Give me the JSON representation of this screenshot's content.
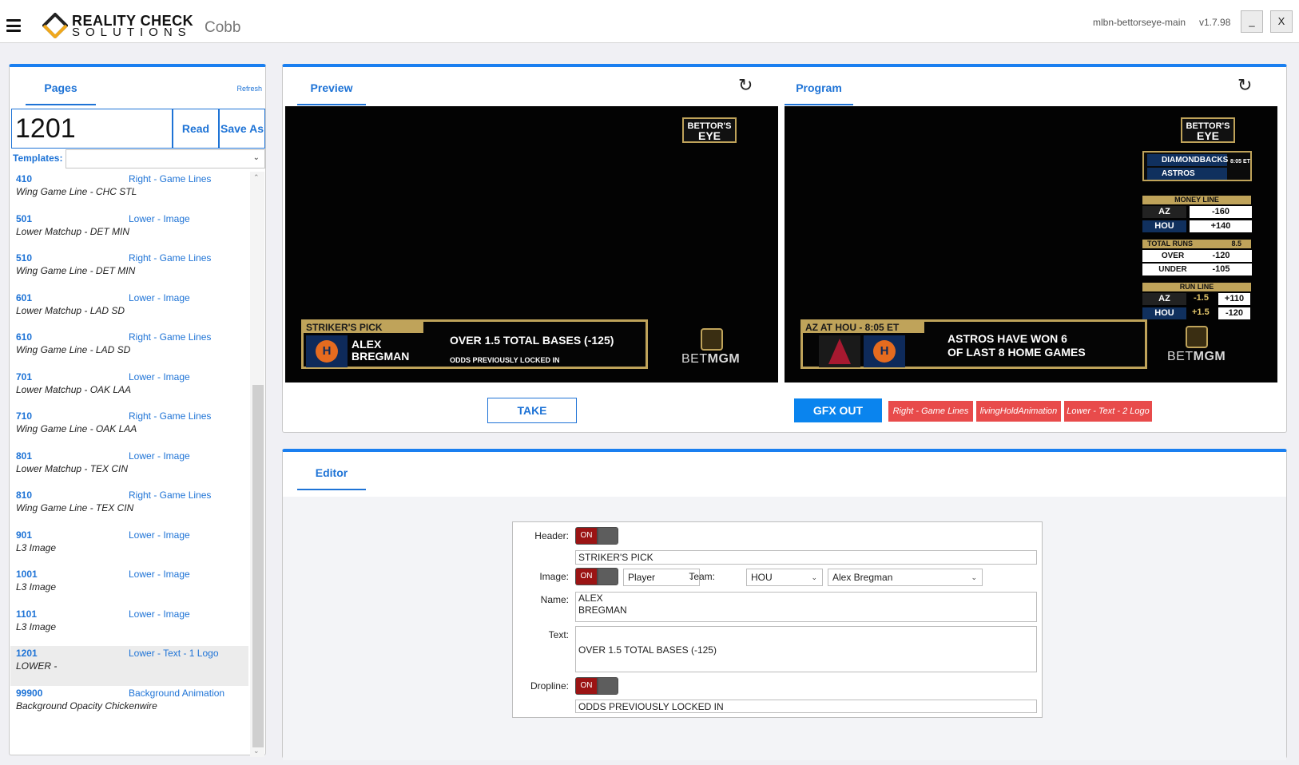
{
  "app": {
    "logo_line1": "REALITY CHECK",
    "logo_line2": "SOLUTIONS",
    "station": "Cobb",
    "app_name": "mlbn-bettorseye-main",
    "version": "v1.7.98",
    "minimize_label": "_",
    "close_label": "X"
  },
  "pages": {
    "tab_label": "Pages",
    "refresh_label": "Refresh",
    "page_number": "1201",
    "read_label": "Read",
    "save_as_label": "Save As",
    "templates_label": "Templates:",
    "items": [
      {
        "num": "410",
        "template": "Right - Game Lines",
        "desc": "Wing Game Line - CHC STL"
      },
      {
        "num": "501",
        "template": "Lower - Image",
        "desc": "Lower Matchup - DET MIN"
      },
      {
        "num": "510",
        "template": "Right - Game Lines",
        "desc": "Wing Game Line - DET MIN"
      },
      {
        "num": "601",
        "template": "Lower - Image",
        "desc": "Lower Matchup - LAD SD"
      },
      {
        "num": "610",
        "template": "Right - Game Lines",
        "desc": "Wing Game Line - LAD SD"
      },
      {
        "num": "701",
        "template": "Lower - Image",
        "desc": "Lower Matchup - OAK LAA"
      },
      {
        "num": "710",
        "template": "Right - Game Lines",
        "desc": "Wing Game Line - OAK LAA"
      },
      {
        "num": "801",
        "template": "Lower - Image",
        "desc": "Lower Matchup - TEX CIN"
      },
      {
        "num": "810",
        "template": "Right - Game Lines",
        "desc": "Wing Game Line - TEX CIN"
      },
      {
        "num": "901",
        "template": "Lower - Image",
        "desc": "L3 Image"
      },
      {
        "num": "1001",
        "template": "Lower - Image",
        "desc": "L3 Image"
      },
      {
        "num": "1101",
        "template": "Lower - Image",
        "desc": "L3 Image"
      },
      {
        "num": "1201",
        "template": "Lower - Text - 1 Logo",
        "desc": "LOWER -"
      },
      {
        "num": "99900",
        "template": "Background Animation",
        "desc": "Background Opacity Chickenwire"
      }
    ]
  },
  "preview": {
    "tab_label": "Preview",
    "logo_line1": "BETTOR'S",
    "logo_line2": "EYE",
    "header": "STRIKER'S PICK",
    "name_line1": "ALEX",
    "name_line2": "BREGMAN",
    "text": "OVER 1.5 TOTAL BASES (-125)",
    "dropline": "ODDS PREVIOUSLY LOCKED IN",
    "betmgm_a": "BET",
    "betmgm_b": "MGM",
    "take_label": "TAKE"
  },
  "program": {
    "tab_label": "Program",
    "logo_line1": "BETTOR'S",
    "logo_line2": "EYE",
    "team1": "DIAMONDBACKS",
    "team2": "ASTROS",
    "time": "8:05 ET",
    "money_line_label": "MONEY LINE",
    "ml_team1": "AZ",
    "ml_val1": "-160",
    "ml_team2": "HOU",
    "ml_val2": "+140",
    "total_runs_label": "TOTAL RUNS",
    "total_runs_val": "8.5",
    "over_label": "OVER",
    "over_val": "-120",
    "under_label": "UNDER",
    "under_val": "-105",
    "run_line_label": "RUN LINE",
    "rl_team1": "AZ",
    "rl_spread1": "-1.5",
    "rl_val1": "+110",
    "rl_team2": "HOU",
    "rl_spread2": "+1.5",
    "rl_val2": "-120",
    "lower_header": "AZ AT HOU - 8:05 ET",
    "lower_line1": "ASTROS HAVE WON 6",
    "lower_line2": "OF LAST 8 HOME GAMES",
    "betmgm_a": "BET",
    "betmgm_b": "MGM",
    "gfx_out_label": "GFX OUT",
    "chips": [
      "Right - Game Lines",
      "livingHoldAnimation",
      "Lower - Text - 2 Logo"
    ]
  },
  "editor": {
    "tab_label": "Editor",
    "header_label": "Header:",
    "header_toggle": "ON",
    "header_value": "STRIKER'S PICK",
    "image_label": "Image:",
    "image_toggle": "ON",
    "image_type": "Player",
    "team_label": "Team:",
    "team_value": "HOU",
    "player_value": "Alex Bregman",
    "name_label": "Name:",
    "name_line1": "ALEX",
    "name_line2": "BREGMAN",
    "text_label": "Text:",
    "text_value": "OVER 1.5 TOTAL BASES (-125)",
    "dropline_label": "Dropline:",
    "dropline_toggle": "ON",
    "dropline_value": "ODDS PREVIOUSLY LOCKED IN"
  },
  "colors": {
    "accent": "#1a7ff0",
    "gold": "#bfa35a",
    "chip_red": "#e84b4b",
    "toggle_on": "#9b1414"
  }
}
